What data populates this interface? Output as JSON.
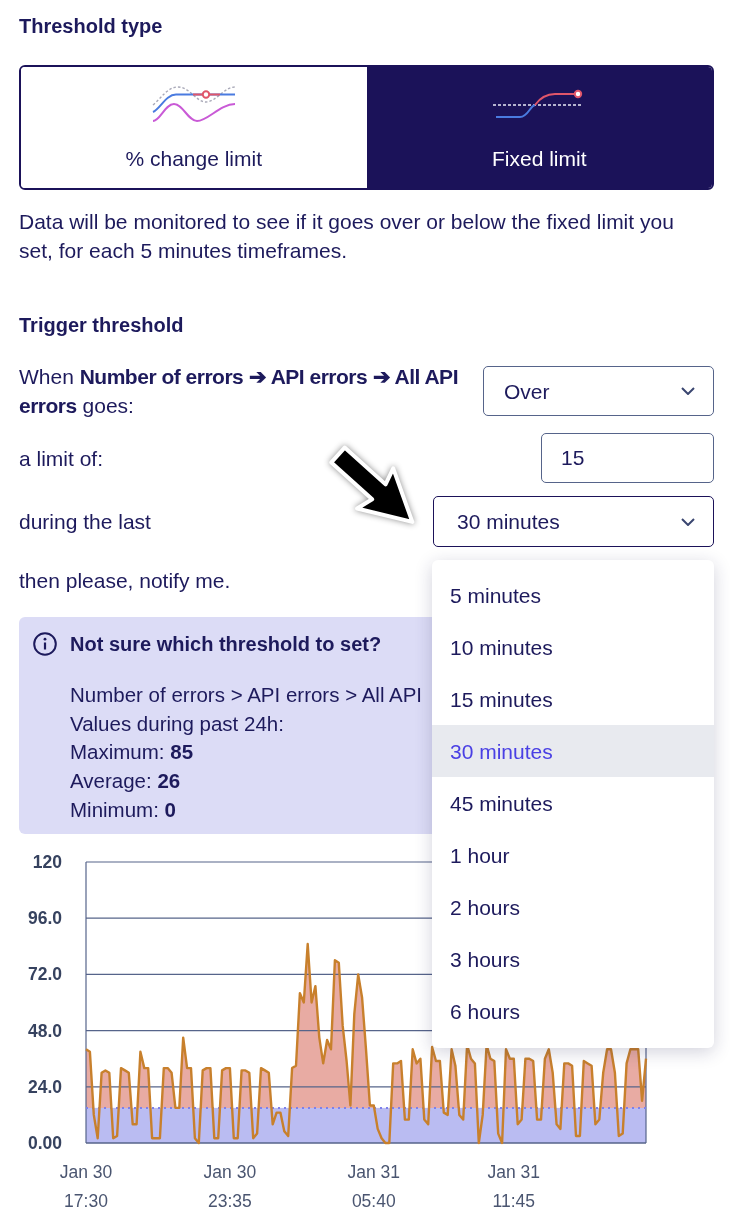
{
  "threshold_type": {
    "title": "Threshold type",
    "options": [
      {
        "kind": "percent_change",
        "label": "% change limit",
        "selected": false
      },
      {
        "kind": "fixed",
        "label": "Fixed limit",
        "selected": true
      }
    ],
    "description": "Data will be monitored to see if it goes over or below the fixed limit you set, for each 5 minutes timeframes."
  },
  "trigger": {
    "title": "Trigger threshold",
    "rows": [
      {
        "kind": "select",
        "label": "When **Number of errors ➔ API errors ➔ All API errors** goes:",
        "value": "Over",
        "expanded": false
      },
      {
        "kind": "input",
        "label": "a limit of:",
        "value": "15"
      },
      {
        "kind": "select",
        "label": "during the last",
        "value": "30 minutes",
        "expanded": true,
        "options": [
          {
            "label": "5 minutes",
            "selected": false
          },
          {
            "label": "10 minutes",
            "selected": false
          },
          {
            "label": "15 minutes",
            "selected": false
          },
          {
            "label": "30 minutes",
            "selected": true
          },
          {
            "label": "45 minutes",
            "selected": false
          },
          {
            "label": "1 hour",
            "selected": false
          },
          {
            "label": "2 hours",
            "selected": false
          },
          {
            "label": "3 hours",
            "selected": false
          },
          {
            "label": "6 hours",
            "selected": false
          }
        ]
      },
      {
        "kind": "text",
        "label": "then please, notify me."
      }
    ]
  },
  "hint": {
    "title": "Not sure which threshold to set?",
    "lines": [
      "Number of errors > API errors > All API",
      "Values during past 24h:",
      "Maximum: **85**",
      "Average: **26**",
      "Minimum: **0**"
    ]
  },
  "history": {
    "chart_data": {
      "type": "area",
      "categories": [
        "Jan 30\n17:30",
        null,
        null,
        null,
        null,
        null,
        null,
        null,
        null,
        null,
        null,
        null,
        null,
        null,
        null,
        null,
        null,
        null,
        null,
        null,
        null,
        null,
        null,
        null,
        null,
        null,
        null,
        null,
        null,
        null,
        null,
        null,
        null,
        null,
        null,
        null,
        null,
        "Jan 30\n23:35",
        null,
        null,
        null,
        null,
        null,
        null,
        null,
        null,
        null,
        null,
        null,
        null,
        null,
        null,
        null,
        null,
        null,
        null,
        null,
        null,
        null,
        null,
        null,
        null,
        null,
        null,
        null,
        null,
        null,
        null,
        null,
        null,
        null,
        null,
        null,
        null,
        "Jan 31\n05:40",
        null,
        null,
        null,
        null,
        null,
        null,
        null,
        null,
        null,
        null,
        null,
        null,
        null,
        null,
        null,
        null,
        null,
        null,
        null,
        null,
        null,
        null,
        null,
        null,
        null,
        null,
        null,
        null,
        null,
        null,
        null,
        null,
        null,
        null,
        null,
        "Jan 31\n11:45",
        null,
        null,
        null,
        null,
        null,
        null,
        null,
        null,
        null,
        null,
        null,
        null,
        null,
        null,
        null,
        null,
        null,
        null,
        null,
        null,
        null,
        null,
        null,
        null,
        null,
        null,
        null,
        null,
        null,
        null,
        null,
        null,
        null,
        null
      ],
      "series": [
        {
          "color": "#c8802c",
          "values": [
            40,
            39,
            12,
            2,
            30,
            31,
            30,
            2,
            3,
            32,
            31,
            30,
            8,
            8,
            39,
            32,
            32,
            2,
            2,
            2,
            32,
            32,
            30,
            15,
            15,
            45,
            32,
            32,
            2,
            0,
            31,
            32,
            32,
            2,
            2,
            31,
            32,
            32,
            2,
            2,
            31,
            31,
            30,
            2,
            4,
            32,
            31,
            30,
            8,
            13,
            13,
            5,
            3,
            32,
            33,
            64,
            60,
            85,
            60,
            67,
            45,
            34,
            44,
            40,
            78,
            77,
            50,
            35,
            16,
            55,
            72,
            62,
            40,
            16,
            16,
            6,
            2,
            0,
            0,
            34,
            34,
            35,
            10,
            10,
            40,
            34,
            36,
            10,
            8,
            41,
            35,
            35,
            13,
            12,
            40,
            33,
            12,
            10,
            42,
            36,
            34,
            0,
            12,
            42,
            36,
            35,
            4,
            0,
            40,
            36,
            36,
            8,
            10,
            36,
            36,
            35,
            10,
            10,
            36,
            40,
            30,
            8,
            6,
            34,
            34,
            33,
            3,
            3,
            35,
            34,
            33,
            8,
            10,
            30,
            40,
            40,
            30,
            3,
            4,
            34,
            40,
            40,
            40,
            18,
            36
          ]
        }
      ],
      "ylim": [
        0,
        120
      ],
      "yticks": [
        {
          "value": 0,
          "label": "0.00"
        },
        {
          "value": 24,
          "label": "24.0"
        },
        {
          "value": 48,
          "label": "48.0"
        },
        {
          "value": 72,
          "label": "72.0"
        },
        {
          "value": 96,
          "label": "96.0"
        },
        {
          "value": 120,
          "label": "120"
        }
      ],
      "grid": true,
      "ref_lines": [
        {
          "axis": "y",
          "value": 15,
          "color": "#7d80ea"
        }
      ],
      "bands": [
        {
          "axis": "y",
          "from": 0,
          "to": 15,
          "color": "#babcf2"
        }
      ]
    }
  }
}
